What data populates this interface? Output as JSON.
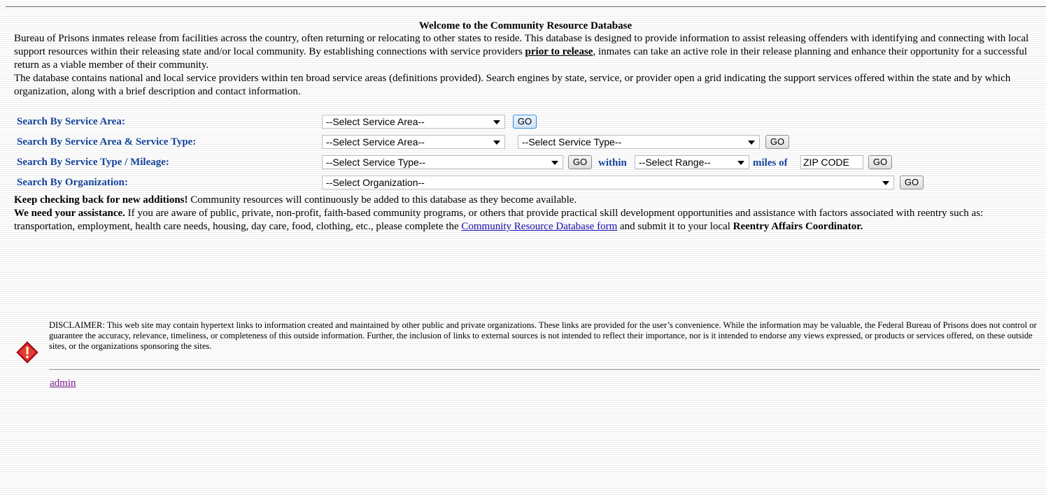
{
  "page": {
    "title": "Welcome to the Community Resource Database",
    "intro_p1_a": "Bureau of Prisons inmates release from facilities across the country, often returning or relocating to other states to reside. This database is designed to provide information to assist releasing offenders with identifying and connecting with local support resources within their releasing state and/or local community. By establishing connections with service providers ",
    "intro_p1_em": "prior to release",
    "intro_p1_b": ", inmates can take an active role in their release planning and enhance their opportunity for a successful return as a viable member of their community.",
    "intro_p2": "The database contains national and local service providers within ten broad service areas (definitions provided). Search engines by state, service, or provider open a grid indicating the support services offered within the state and by which organization, along with a brief description and contact information."
  },
  "search": {
    "by_area": {
      "label": "Search By Service Area:",
      "select": "--Select Service Area--",
      "go": "GO"
    },
    "by_area_type": {
      "label": "Search By Service Area & Service Type:",
      "select_area": "--Select Service Area--",
      "select_type": "--Select Service Type--",
      "go": "GO"
    },
    "by_type_mileage": {
      "label": "Search By Service Type / Mileage:",
      "select_type": "--Select Service Type--",
      "go1": "GO",
      "within": "within",
      "select_range": "--Select Range--",
      "miles_of": "miles of",
      "zip_value": "ZIP CODE",
      "go2": "GO"
    },
    "by_org": {
      "label": "Search By Organization:",
      "select": "--Select Organization--",
      "go": "GO"
    }
  },
  "notes": {
    "keep_bold": "Keep checking back for new additions!",
    "keep_rest": " Community resources will continuously be added to this database as they become available.",
    "need_bold": "We need your assistance.",
    "need_rest": " If you are aware of public, private, non-profit, faith-based community programs, or others that provide practical skill development opportunities and assistance with factors associated with reentry such as: transportation, employment, health care needs, housing, day care, food, clothing, etc., please complete the ",
    "form_link": "Community Resource Database form",
    "need_after": " and submit it to your local ",
    "coordinator": "Reentry Affairs Coordinator."
  },
  "disclaimer": {
    "text": "DISCLAIMER: This web site may contain hypertext links to information created and maintained by other public and private organizations. These links are provided for the user’s convenience. While the information may be valuable, the Federal Bureau of Prisons does not control or guarantee the accuracy, relevance, timeliness, or completeness of this outside information. Further, the inclusion of links to external sources is not intended to reflect their importance, nor is it intended to endorse any views expressed, or products or services offered, on these outside sites, or the organizations sponsoring the sites."
  },
  "admin_link": "admin",
  "icons": {
    "warning": "warning-icon"
  },
  "colors": {
    "label_blue": "#15449b",
    "link": "#1a0dab",
    "visited": "#7a1a8c",
    "warning_red": "#c8101a"
  }
}
